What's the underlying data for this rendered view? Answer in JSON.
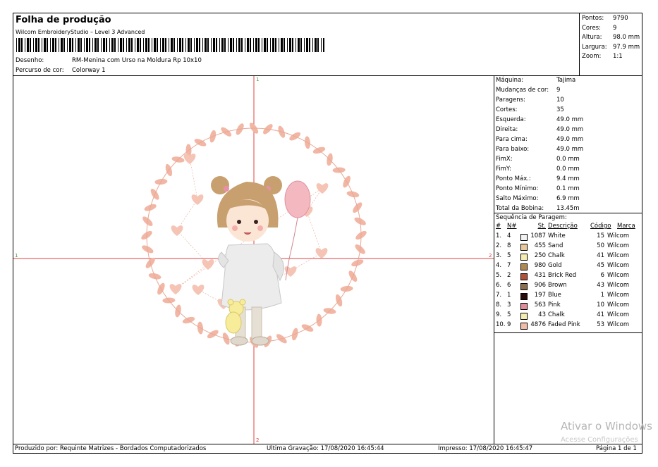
{
  "header": {
    "title": "Folha de produção",
    "subtitle": "Wilcom EmbroideryStudio – Level 3 Advanced",
    "design_label": "Desenho:",
    "design_value": "RM-Menina com Urso na Moldura Rp 10x10",
    "colorway_label": "Percurso de cor:",
    "colorway_value": "Colorway 1"
  },
  "stats": [
    {
      "label": "Pontos:",
      "value": "9790"
    },
    {
      "label": "Cores:",
      "value": "9"
    },
    {
      "label": "Altura:",
      "value": "98.0 mm"
    },
    {
      "label": "Largura:",
      "value": "97.9 mm"
    },
    {
      "label": "Zoom:",
      "value": "1:1"
    }
  ],
  "params": [
    {
      "label": "Máquina:",
      "value": "Tajima"
    },
    {
      "label": "Mudanças de cor:",
      "value": "9"
    },
    {
      "label": "Paragens:",
      "value": "10"
    },
    {
      "label": "Cortes:",
      "value": "35"
    },
    {
      "label": "Esquerda:",
      "value": "49.0 mm"
    },
    {
      "label": "Direita:",
      "value": "49.0 mm"
    },
    {
      "label": "Para cima:",
      "value": "49.0 mm"
    },
    {
      "label": "Para baixo:",
      "value": "49.0 mm"
    },
    {
      "label": "FimX:",
      "value": "0.0 mm"
    },
    {
      "label": "FimY:",
      "value": "0.0 mm"
    },
    {
      "label": "Ponto Máx.:",
      "value": "9.4 mm"
    },
    {
      "label": "Ponto Mínimo:",
      "value": "0.1 mm"
    },
    {
      "label": "Salto Máximo:",
      "value": "6.9 mm"
    },
    {
      "label": "Total da Bobina:",
      "value": "13.45m"
    }
  ],
  "sequence": {
    "title": "Sequência de Paragem:",
    "columns": {
      "num": "#",
      "n": "N#",
      "st": "St.",
      "desc": "Descrição",
      "code": "Código",
      "brand": "Marca"
    },
    "rows": [
      {
        "num": "1.",
        "n": "4",
        "color": "#f2f2f2",
        "st": "1087",
        "desc": "White",
        "code": "15",
        "brand": "Wilcom"
      },
      {
        "num": "2.",
        "n": "8",
        "color": "#e8c79a",
        "st": "455",
        "desc": "Sand",
        "code": "50",
        "brand": "Wilcom"
      },
      {
        "num": "3.",
        "n": "5",
        "color": "#f5ecb0",
        "st": "250",
        "desc": "Chalk",
        "code": "41",
        "brand": "Wilcom"
      },
      {
        "num": "4.",
        "n": "7",
        "color": "#b08850",
        "st": "980",
        "desc": "Gold",
        "code": "45",
        "brand": "Wilcom"
      },
      {
        "num": "5.",
        "n": "2",
        "color": "#b0523a",
        "st": "431",
        "desc": "Brick Red",
        "code": "6",
        "brand": "Wilcom"
      },
      {
        "num": "6.",
        "n": "6",
        "color": "#8b6e50",
        "st": "906",
        "desc": "Brown",
        "code": "43",
        "brand": "Wilcom"
      },
      {
        "num": "7.",
        "n": "1",
        "color": "#2a0a0a",
        "st": "197",
        "desc": "Blue",
        "code": "1",
        "brand": "Wilcom"
      },
      {
        "num": "8.",
        "n": "3",
        "color": "#e08a9a",
        "st": "563",
        "desc": "Pink",
        "code": "10",
        "brand": "Wilcom"
      },
      {
        "num": "9.",
        "n": "5",
        "color": "#f5ecb0",
        "st": "43",
        "desc": "Chalk",
        "code": "41",
        "brand": "Wilcom"
      },
      {
        "num": "10.",
        "n": "9",
        "color": "#f3bca8",
        "st": "4876",
        "desc": "Faded Pink",
        "code": "53",
        "brand": "Wilcom"
      }
    ]
  },
  "axes": {
    "top": "1",
    "bottom": "2",
    "left": "1",
    "right": "2"
  },
  "footer": {
    "produced_by": "Produzido por: Requinte Matrizes - Bordados Computadorizados",
    "last_save": "Ultima Gravação: 17/08/2020 16:45:44",
    "printed": "Impresso: 17/08/2020 16:45:47",
    "page": "Página 1 de 1"
  },
  "watermark": {
    "line1": "Ativar o Windows",
    "line2": "Acesse Configurações"
  },
  "colors": {
    "crosshair": "#e04040",
    "frame_pink": "#f2b6a4",
    "heart_pink": "#f5c4b4"
  }
}
